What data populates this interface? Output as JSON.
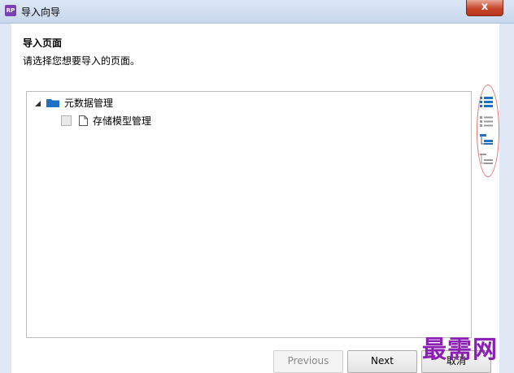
{
  "window": {
    "title": "导入向导",
    "logo_text": "RP",
    "close_glyph": "x"
  },
  "page": {
    "heading": "导入页面",
    "subheading": "请选择您想要导入的页面。"
  },
  "tree": {
    "root": {
      "label": "元数据管理",
      "expanded": true,
      "icon": "folder-icon"
    },
    "children": [
      {
        "label": "存储模型管理",
        "checked": false,
        "icon": "page-icon"
      }
    ]
  },
  "toolbar": {
    "icons": [
      "check-all-icon",
      "uncheck-all-icon",
      "check-children-icon",
      "uncheck-children-icon"
    ]
  },
  "buttons": {
    "previous": "Previous",
    "next": "Next",
    "cancel": "取消"
  },
  "watermark": "最需网",
  "colors": {
    "accent": "#1f6fc2",
    "annotation": "#e0746e",
    "watermark": "#8b1fb3"
  }
}
